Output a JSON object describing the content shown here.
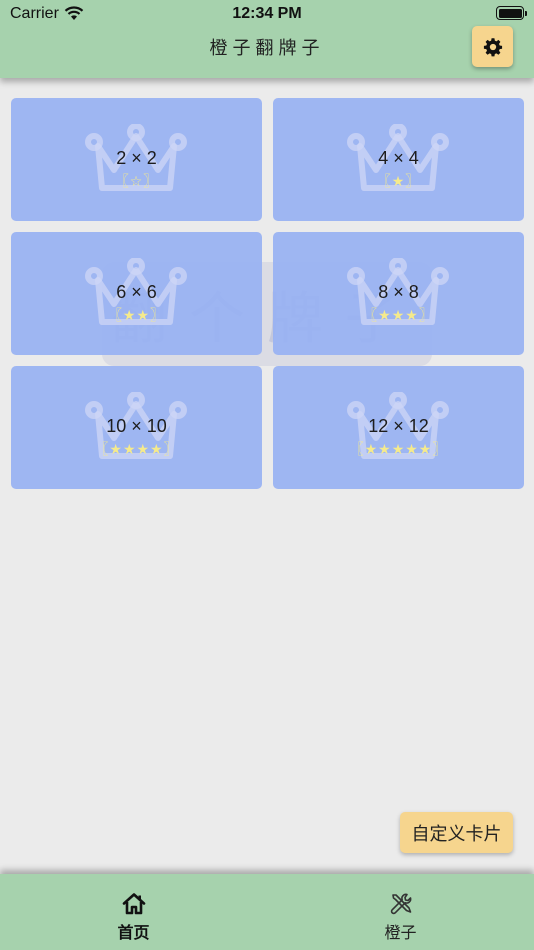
{
  "status_bar": {
    "carrier": "Carrier",
    "time": "12:34 PM"
  },
  "header": {
    "title": "橙子翻牌子",
    "settings_icon": "gear-icon"
  },
  "watermark_text": "翻个牌子",
  "levels": [
    {
      "size": "2 × 2",
      "stars": "〖☆〗"
    },
    {
      "size": "4 × 4",
      "stars": "〖★〗"
    },
    {
      "size": "6 × 6",
      "stars": "〖★★〗"
    },
    {
      "size": "8 × 8",
      "stars": "〖★★★〗"
    },
    {
      "size": "10 × 10",
      "stars": "〖★★★★〗"
    },
    {
      "size": "12 × 12",
      "stars": "〖★★★★★〗"
    }
  ],
  "custom_button": "自定义卡片",
  "tabs": [
    {
      "label": "首页",
      "icon": "home-icon",
      "active": true
    },
    {
      "label": "橙子",
      "icon": "tools-icon",
      "active": false
    }
  ],
  "colors": {
    "header_bg": "#a6d2ad",
    "accent_button": "#f6d58e",
    "card_bg": "#96b0f3",
    "star": "#f5ea8c",
    "page_bg": "#ebebeb"
  }
}
